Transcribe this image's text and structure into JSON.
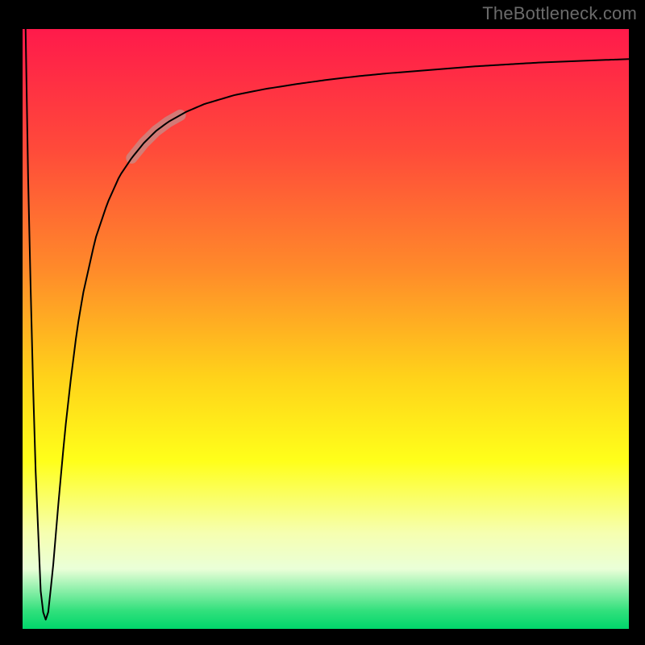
{
  "domain": "Chart",
  "watermark": "TheBottleneck.com",
  "chart_data": {
    "type": "line",
    "title": "",
    "xlabel": "",
    "ylabel": "",
    "xlim": [
      0,
      100
    ],
    "ylim": [
      0,
      100
    ],
    "grid": false,
    "legend": false,
    "background_gradient": {
      "stops": [
        {
          "pos": 0.0,
          "color": "#ff1a4b"
        },
        {
          "pos": 0.2,
          "color": "#ff4a3a"
        },
        {
          "pos": 0.4,
          "color": "#ff8a2a"
        },
        {
          "pos": 0.58,
          "color": "#ffd21a"
        },
        {
          "pos": 0.72,
          "color": "#ffff1a"
        },
        {
          "pos": 0.84,
          "color": "#f6ffb0"
        },
        {
          "pos": 0.9,
          "color": "#eaffd8"
        },
        {
          "pos": 0.97,
          "color": "#31e07c"
        },
        {
          "pos": 1.0,
          "color": "#00d66b"
        }
      ]
    },
    "series": [
      {
        "name": "curve",
        "color": "#000000",
        "width": 2,
        "x": [
          0.5,
          1.0,
          2.0,
          3.0,
          3.5,
          3.8,
          4.2,
          5.0,
          6.0,
          7.0,
          8.0,
          9.0,
          10.0,
          12.0,
          14.0,
          16.0,
          18.0,
          20.0,
          22.0,
          24.0,
          27.0,
          30.0,
          35.0,
          40.0,
          45.0,
          50.0,
          55.0,
          60.0,
          65.0,
          70.0,
          75.0,
          80.0,
          85.0,
          90.0,
          95.0,
          100.0
        ],
        "y": [
          100.0,
          70.0,
          30.0,
          6.0,
          2.0,
          1.5,
          2.5,
          10.0,
          22.0,
          33.0,
          42.0,
          50.0,
          56.0,
          65.0,
          71.0,
          75.5,
          78.5,
          81.0,
          83.0,
          84.5,
          86.2,
          87.5,
          89.0,
          90.0,
          90.8,
          91.5,
          92.1,
          92.6,
          93.0,
          93.4,
          93.8,
          94.1,
          94.4,
          94.6,
          94.8,
          95.0
        ]
      }
    ],
    "highlight_segment": {
      "series": "curve",
      "x_start": 18.0,
      "x_end": 26.0,
      "color": "#c48d8a",
      "opacity": 0.75,
      "width": 14
    },
    "plot_border": {
      "color": "#000000",
      "width": 12
    }
  }
}
